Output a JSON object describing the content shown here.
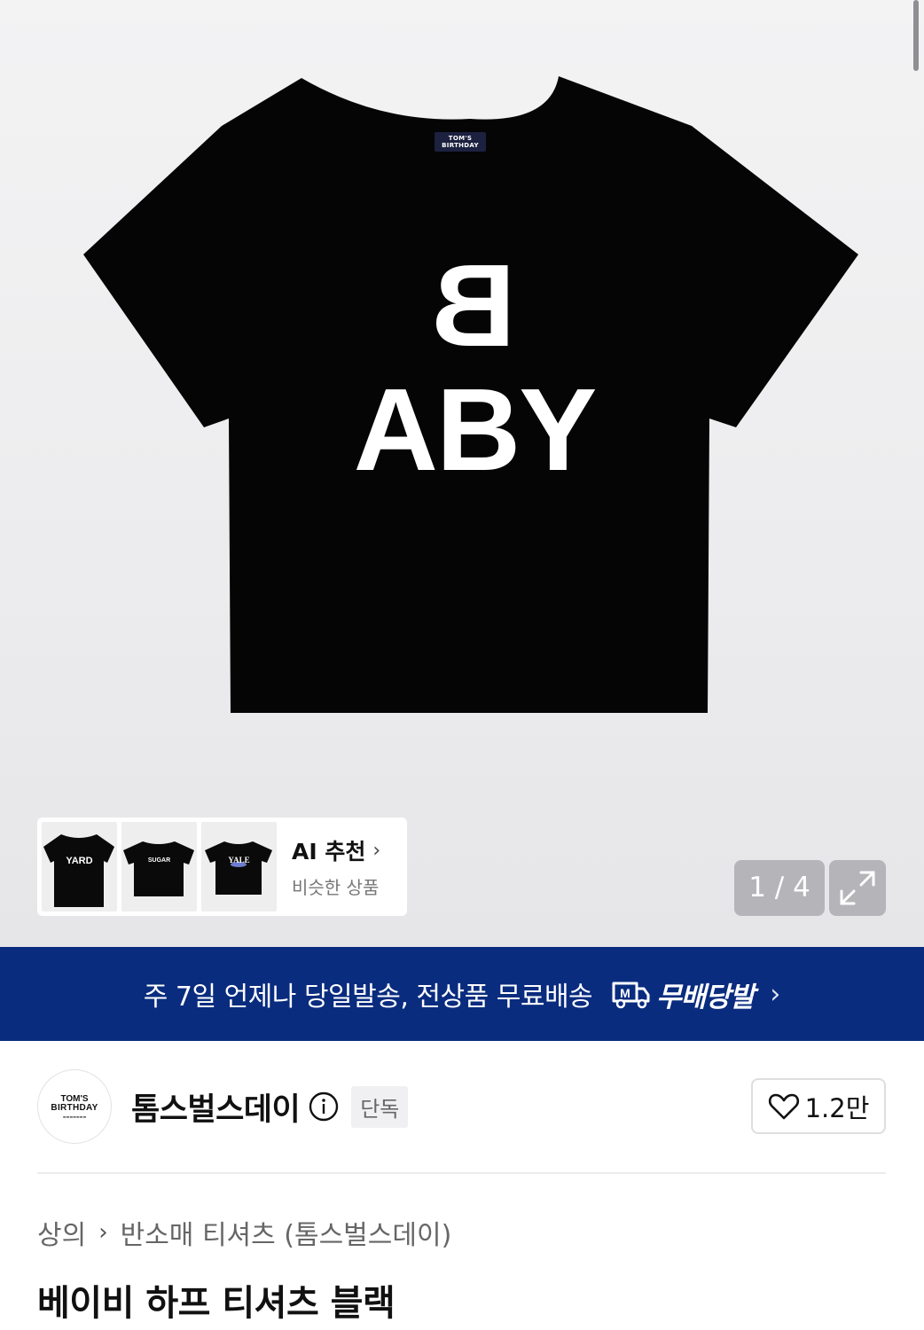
{
  "hero": {
    "image_alt": "black t-shirt",
    "tee_label": [
      "TOM'S",
      "BIRTHDAY"
    ],
    "tee_print": "BABY",
    "pager": "1 / 4"
  },
  "ai_recommend": {
    "title": "AI 추천",
    "subtitle": "비슷한 상품",
    "thumbs": [
      {
        "print": "YARD"
      },
      {
        "print": "SUGAR"
      },
      {
        "print": "YALE"
      }
    ]
  },
  "banner": {
    "text": "주 7일 언제나 당일발송, 전상품 무료배송",
    "logo_text": "무배당발",
    "logo_badge": "M"
  },
  "brand": {
    "avatar_line1": "TOM'S",
    "avatar_line2": "BIRTHDAY",
    "name": "톰스벌스데이",
    "exclusive": "단독",
    "likes": "1.2만"
  },
  "breadcrumb": {
    "category": "상의",
    "subcategory": "반소매 티셔츠 (톰스벌스데이)"
  },
  "product": {
    "title": "베이비 하프 티셔츠 블랙"
  },
  "colors": {
    "banner_bg": "#0a2c7f",
    "shirt": "#050505"
  }
}
